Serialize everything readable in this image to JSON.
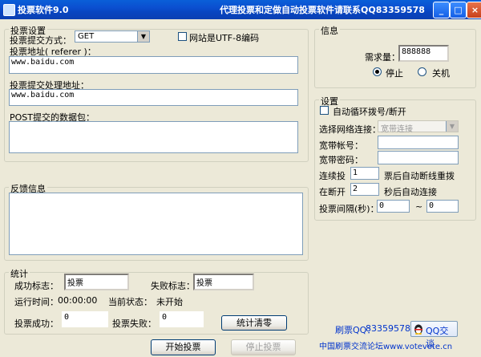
{
  "window": {
    "title": "投票软件9.0",
    "contact": "代理投票和定做自动投票软件请联系QQ83359578",
    "minimize_label": "_",
    "maximize_label": "□",
    "close_label": "×"
  },
  "vote_settings": {
    "legend": "投票设置",
    "method_label": "投票提交方式：",
    "method_value": "GET",
    "utf8_label": "网站是UTF-8编码",
    "referer_label": "投票地址( referer )：",
    "referer_value": "www.baidu.com",
    "handler_label": "投票提交处理地址：",
    "handler_value": "www.baidu.com",
    "post_label": "POST提交的数据包："
  },
  "feedback": {
    "legend": "反馈信息"
  },
  "stats": {
    "legend": "统计",
    "success_flag_label": "成功标志：",
    "success_flag_value": "投票",
    "fail_flag_label": "失败标志：",
    "fail_flag_value": "投票",
    "run_time_label": "运行时间：",
    "run_time_value": "00:00:00",
    "status_label": "当前状态：",
    "status_value": "未开始",
    "vote_success_label": "投票成功：",
    "vote_success_value": "0",
    "vote_fail_label": "投票失败：",
    "vote_fail_value": "0",
    "clear_button": "统计清零"
  },
  "info": {
    "legend": "信息",
    "demand_label": "需求量：",
    "demand_value": "888888",
    "stop_label": "停止",
    "shutdown_label": "关机"
  },
  "settings": {
    "legend": "设置",
    "auto_dial_label": "自动循环拨号/断开",
    "network_label": "选择网络连接：",
    "network_value": "宽带连接",
    "account_label": "宽带帐号：",
    "account_value": "",
    "password_label": "宽带密码：",
    "password_value": "",
    "consecutive_label": "连续投",
    "consecutive_value": "1",
    "consecutive_suffix": "票后自动断线重拨",
    "disconnect_label": "在断开",
    "disconnect_value": "2",
    "disconnect_suffix": "秒后自动连接",
    "interval_label": "投票间隔(秒)：",
    "interval_from": "0",
    "interval_sep": "~",
    "interval_to": "0"
  },
  "footer": {
    "qq_label": "刷票QQ：",
    "qq_value": "83359578",
    "qq_chat_button": "QQ交谈",
    "forum_text": "中国刷票交流论坛www.votevote.cn"
  },
  "actions": {
    "start_button": "开始投票",
    "stop_button": "停止投票"
  },
  "colors": {
    "title_bar": "#0a4fd0",
    "dialog_bg": "#ece9d8",
    "link_blue": "#0033cc"
  }
}
